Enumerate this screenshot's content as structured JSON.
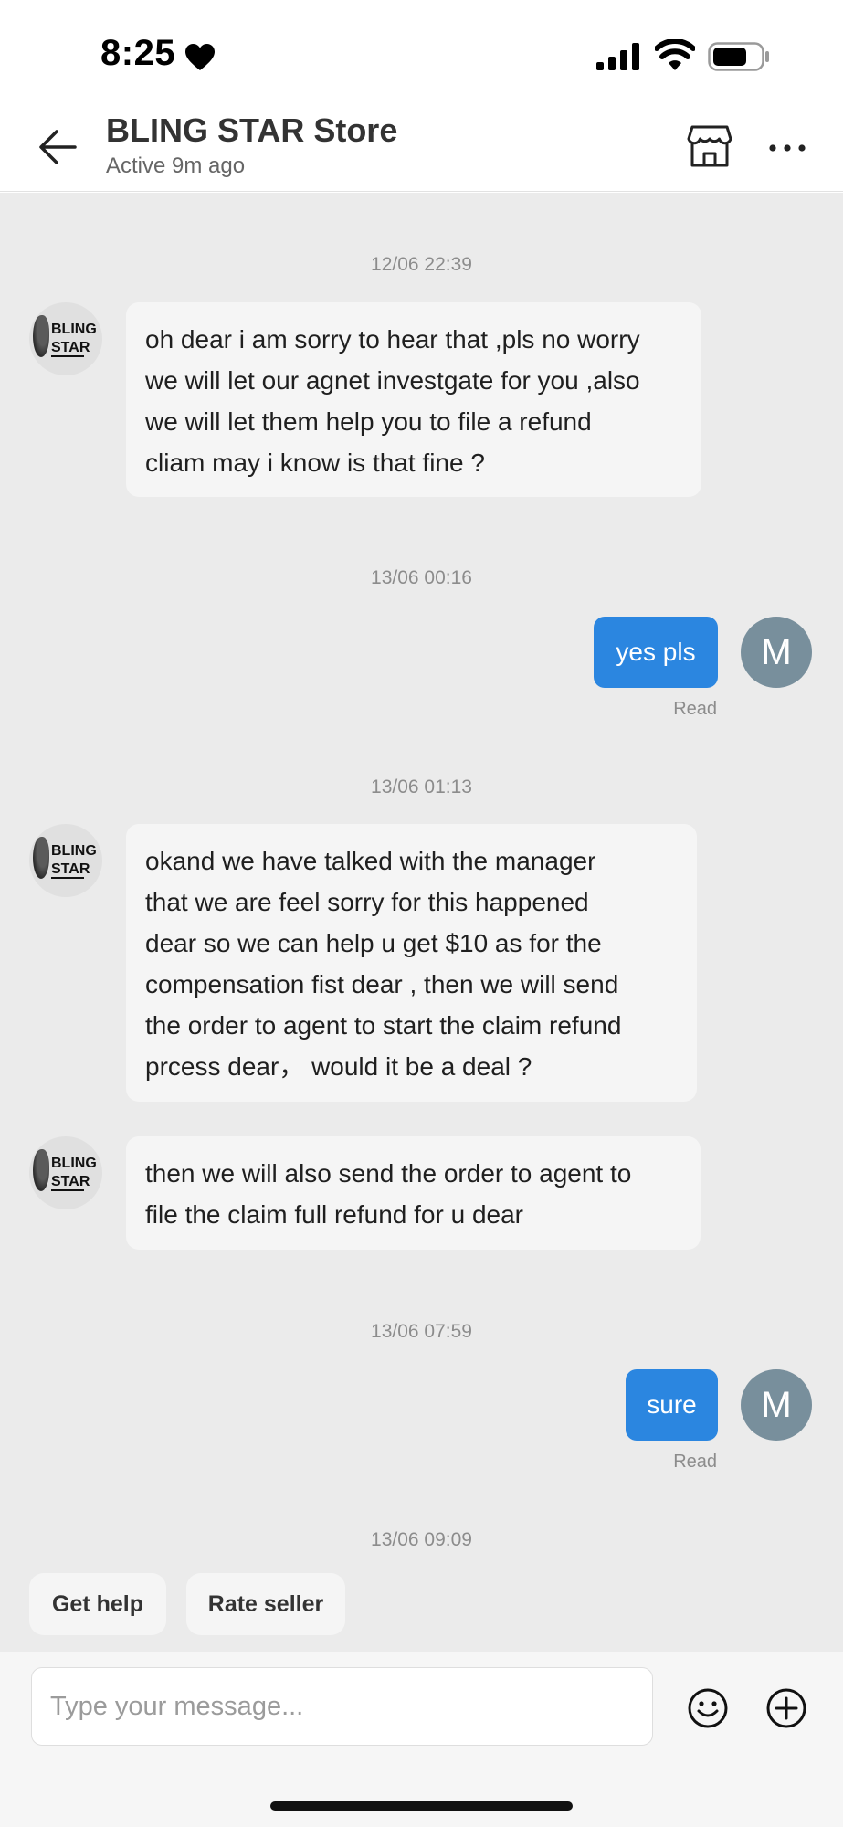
{
  "status_bar": {
    "time": "8:25"
  },
  "header": {
    "title": "BLING STAR Store",
    "subtitle": "Active 9m ago"
  },
  "store_avatar": {
    "line1": "BLING",
    "line2": "STAR"
  },
  "user_avatar": {
    "initial": "M"
  },
  "messages": [
    {
      "timestamp": "12/06 22:39",
      "text": "oh dear i am sorry to hear that ,pls no worry\nwe will let our agnet investgate for you ,also\nwe will let them help you to file a refund\ncliam may i know is that fine ?"
    },
    {
      "timestamp": "13/06 00:16",
      "text": "yes pls",
      "status": "Read"
    },
    {
      "timestamp": "13/06 01:13",
      "text": "okand we have talked with the manager\nthat we are feel sorry for this happened\ndear so we can help u get $10 as for the\ncompensation fist dear , then we will send\nthe order to agent to start the claim refund\nprcess dear，  would it be a deal ?"
    },
    {
      "text": "then we will also send the order to agent to\nfile the claim full refund for u dear"
    },
    {
      "timestamp": "13/06 07:59",
      "text": "sure",
      "status": "Read"
    },
    {
      "timestamp": "13/06 09:09"
    }
  ],
  "quick_replies": [
    "Get help",
    "Rate seller"
  ],
  "composer": {
    "placeholder": "Type your message..."
  },
  "colors": {
    "accent": "#2b86e0",
    "chat_background": "#ebebeb",
    "user_avatar": "#788f9c"
  }
}
